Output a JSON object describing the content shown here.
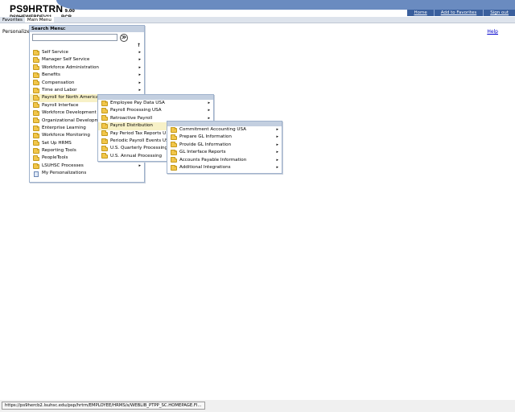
{
  "header": {
    "title": "PS9HRTRN",
    "version": "9.00",
    "server": "PS9HEWEBDEV11",
    "user": "RCB",
    "links": [
      "Home",
      "Add to Favorites",
      "Sign out"
    ]
  },
  "menubar": {
    "favorites": "Favorites",
    "main_menu": "Main Menu"
  },
  "page": {
    "personalize": "Personalize",
    "help": "Help"
  },
  "search_menu": {
    "label": "Search Menu:",
    "go": "≫",
    "scroll_up": "↑"
  },
  "menu1": {
    "items": [
      "Self Service",
      "Manager Self Service",
      "Workforce Administration",
      "Benefits",
      "Compensation",
      "Time and Labor",
      "Payroll for North America",
      "Payroll Interface",
      "Workforce Development",
      "Organizational Developme",
      "Enterprise Learning",
      "Workforce Monitoring",
      "Set Up HRMS",
      "Reporting Tools",
      "PeopleTools",
      "LSUHSC Processes",
      "My Personalizations"
    ]
  },
  "menu2": {
    "items": [
      "Employee Pay Data USA",
      "Payroll Processing USA",
      "Retroactive Payroll",
      "Payroll Distribution",
      "Pay Period Tax Reports U",
      "Periodic Payroll Events US",
      "U.S. Quarterly Processing",
      "U.S. Annual Processing"
    ]
  },
  "menu3": {
    "items": [
      "Commitment Accounting USA",
      "Prepare GL Information",
      "Provide GL Information",
      "GL Interface Reports",
      "Accounts Payable Information",
      "Additional Integrations"
    ]
  },
  "status": {
    "url": "https://ps9hercb2.lsuhsc.edu/psp/hrtrn/EMPLOYEE/HRMS/s/WEBLIB_PTPP_SC.HOMEPAGE.FI..."
  },
  "colors": {
    "accent": "#6a8bc0",
    "highlight": "#f7f1c7",
    "folder": "#f2c64a"
  }
}
